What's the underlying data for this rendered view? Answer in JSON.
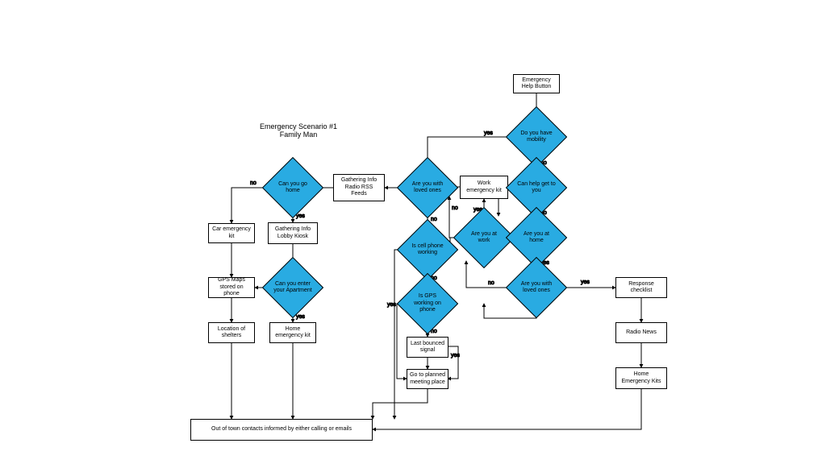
{
  "diagram": {
    "title": "Emergency Scenario #1\nFamily Man",
    "boxes": {
      "help_button": "Emergency Help Button",
      "work_kit": "Work emergency kit",
      "gather_radio": "Gathering Info Radio RSS Feeds",
      "car_kit": "Car emergency kit",
      "gather_lobby": "Gathering Info Lobby Kiosk",
      "gps_maps": "GPS Maps stored on phone",
      "home_kit": "Home emergency kit",
      "shelters": "Location of shelters",
      "last_signal": "Last bounced signal",
      "meeting": "Go to planned meeting place",
      "resp_check": "Response checklist",
      "radio_news": "Radio News",
      "home_kits2": "Home Emergency Kits",
      "out_town": "Out of town contacts informed by either calling or emails"
    },
    "decisions": {
      "mobility": "Do you have mobility",
      "help_get": "Can help get to you",
      "at_work": "Are you at work",
      "at_home": "Are you at home",
      "loved1": "Are you with loved ones",
      "loved2": "Are you with loved ones",
      "cell": "Is cell phone working",
      "gps": "Is GPS working on phone",
      "go_home": "Can you go home",
      "enter_apt": "Can you enter your Apartment"
    },
    "labels": {
      "yes": "yes",
      "no": "no"
    }
  }
}
